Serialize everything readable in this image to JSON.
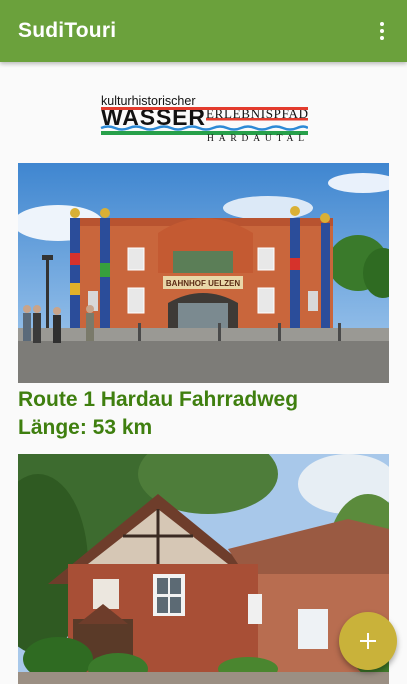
{
  "app": {
    "title": "SudiTouri",
    "colors": {
      "app_bar": "#6ba13c",
      "accent_text": "#3f7f0f",
      "fab": "#c9b23a"
    }
  },
  "menu": {
    "icon": "more-vert-icon"
  },
  "header_logo": {
    "line1": "kulturhistorischer",
    "line2_big": "WASSER",
    "line2_small": "ERLEBNISPFAD",
    "line3": "HARDAUTAL"
  },
  "routes": [
    {
      "image_sign": "BAHNHOF UELZEN",
      "title": "Route 1 Hardau Fahrradweg",
      "length": "Länge: 53 km"
    },
    {
      "image_sign": ""
    }
  ],
  "fab": {
    "icon": "plus-icon"
  }
}
